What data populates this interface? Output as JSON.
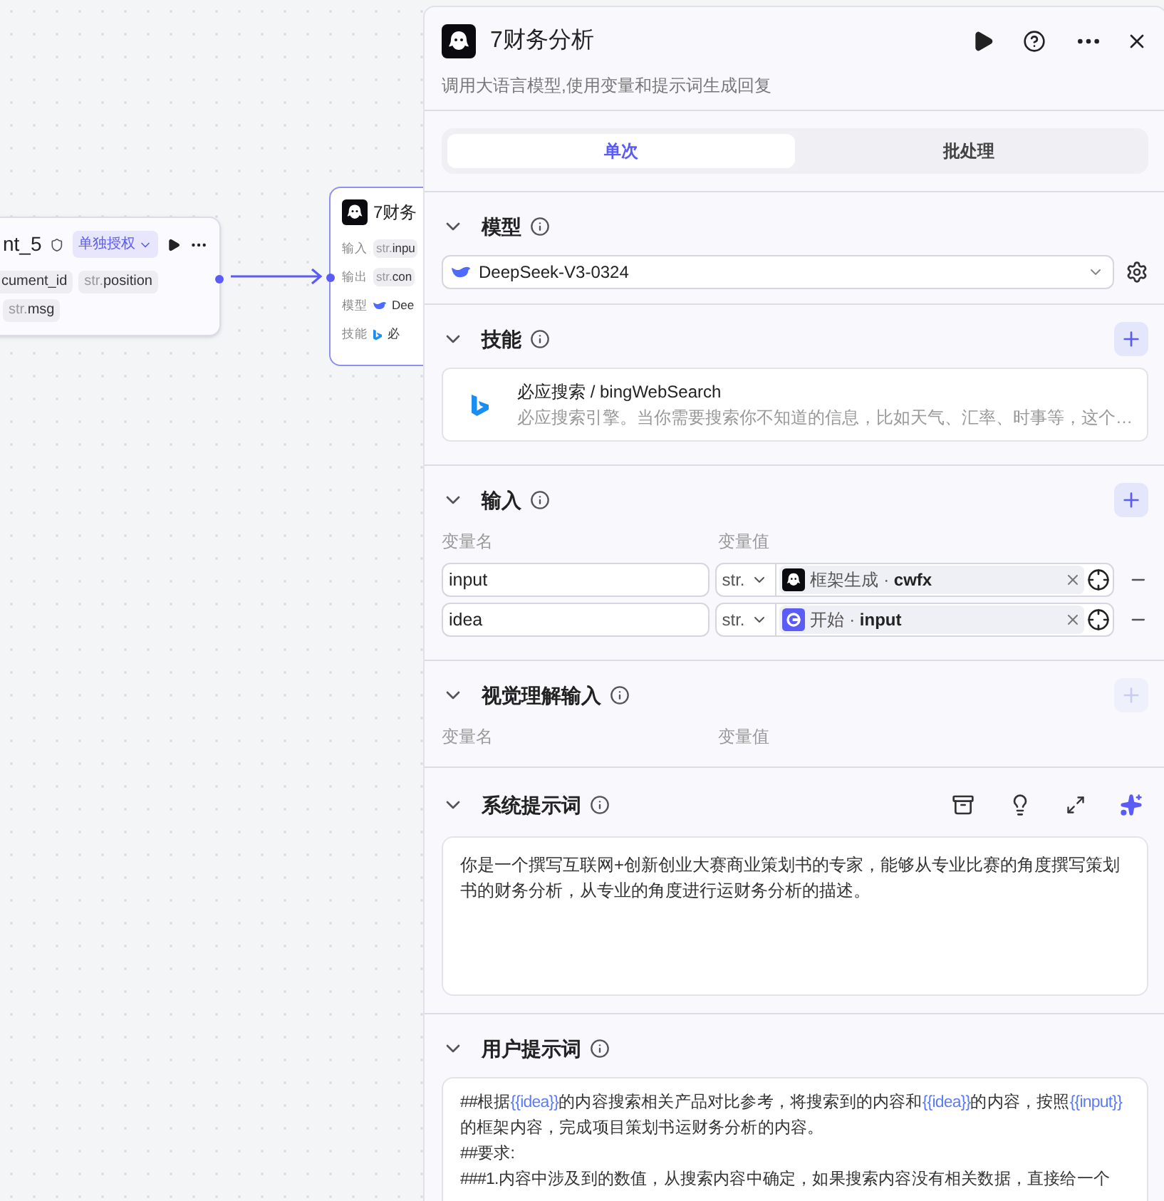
{
  "canvas": {
    "nodes": [
      {
        "kind": "plugin",
        "title": "nt_5",
        "badge": "单独授权",
        "tag_rows": [
          {
            "leading_cut": false,
            "tags": [
              {
                "name": "cument_id"
              },
              {
                "type": "str.",
                "name": "position"
              }
            ]
          },
          {
            "leading_cut": true,
            "tags": [
              {
                "type": "str.",
                "name": "msg"
              }
            ]
          }
        ]
      },
      {
        "kind": "llm",
        "title": "7财务",
        "rows": [
          {
            "label": "输入",
            "type": "str.",
            "value": "inpu"
          },
          {
            "label": "输出",
            "type": "str.",
            "value": "con"
          },
          {
            "label": "模型",
            "value": "Dee"
          },
          {
            "label": "技能",
            "value": "必"
          }
        ]
      }
    ]
  },
  "panel": {
    "title": "7财务分析",
    "subtitle": "调用大语言模型,使用变量和提示词生成回复",
    "tabs": [
      {
        "label": "单次",
        "selected": true
      },
      {
        "label": "批处理",
        "selected": false
      }
    ],
    "model": {
      "title": "模型",
      "expanded": true,
      "value": "DeepSeek-V3-0324"
    },
    "skills": {
      "title": "技能",
      "expanded": true,
      "items": [
        {
          "name": "必应搜索 / bingWebSearch",
          "description": "必应搜索引擎。当你需要搜索你不知道的信息，比如天气、汇率、时事等，这个…"
        }
      ]
    },
    "inputs": {
      "title": "输入",
      "expanded": true,
      "add_disabled": false,
      "col_name": "变量名",
      "col_value": "变量值",
      "rows": [
        {
          "name": "input",
          "type": "str.",
          "kind": "llm",
          "ref": "框架生成 · **cwfx**"
        },
        {
          "name": "idea",
          "type": "str.",
          "kind": "start",
          "ref": "开始 · **input**"
        }
      ]
    },
    "vision": {
      "title": "视觉理解输入",
      "expanded": true,
      "add_disabled": true,
      "col_name": "变量名",
      "col_value": "变量值"
    },
    "system_prompt": {
      "title": "系统提示词",
      "expanded": true,
      "text": "你是一个撰写互联网+创新创业大赛商业策划书的专家，能够从专业比赛的角度撰写策划书的财务分析，从专业的角度进行运财务分析的描述。"
    },
    "user_prompt": {
      "title": "用户提示词",
      "expanded": true,
      "lines": [
        [
          {
            "kind": "text",
            "text": "##根据"
          },
          {
            "kind": "var",
            "text": "{{idea}}"
          },
          {
            "kind": "text",
            "text": "的内容搜索相关产品对比参考，将搜索到的内容和"
          },
          {
            "kind": "var",
            "text": "{{idea}}"
          },
          {
            "kind": "text",
            "text": "的内容，按照"
          },
          {
            "kind": "var",
            "text": "{{input}}"
          },
          {
            "kind": "text",
            "text": "的框架内容，完成项目策划书运财务分析的内容。"
          }
        ],
        [
          {
            "kind": "text",
            "text": "##要求:"
          }
        ],
        [
          {
            "kind": "text",
            "text": "###1.内容中涉及到的数值，从搜索内容中确定，如果搜索内容没有相关数据，直接给一个"
          }
        ]
      ]
    }
  }
}
